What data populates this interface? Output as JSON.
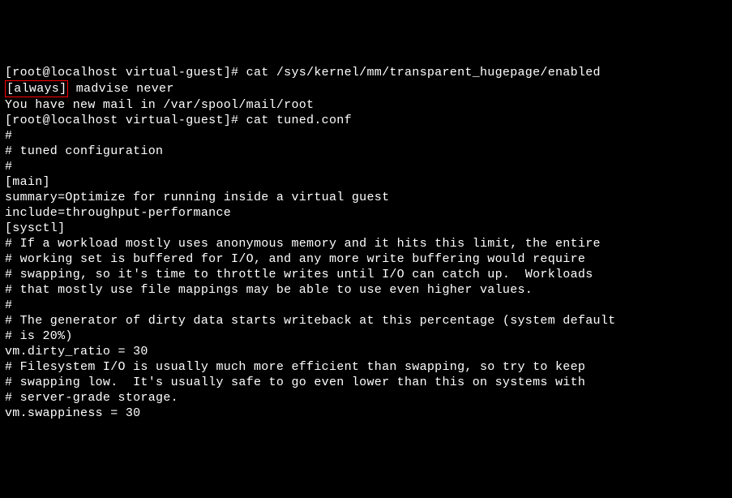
{
  "terminal": {
    "lines": [
      "[root@localhost virtual-guest]# cat /sys/kernel/mm/transparent_hugepage/enabled",
      "",
      " madvise never",
      "You have new mail in /var/spool/mail/root",
      "[root@localhost virtual-guest]# cat tuned.conf",
      "#",
      "# tuned configuration",
      "#",
      "",
      "[main]",
      "summary=Optimize for running inside a virtual guest",
      "include=throughput-performance",
      "",
      "[sysctl]",
      "# If a workload mostly uses anonymous memory and it hits this limit, the entire",
      "# working set is buffered for I/O, and any more write buffering would require",
      "# swapping, so it's time to throttle writes until I/O can catch up.  Workloads",
      "# that mostly use file mappings may be able to use even higher values.",
      "#",
      "# The generator of dirty data starts writeback at this percentage (system default",
      "# is 20%)",
      "vm.dirty_ratio = 30",
      "",
      "# Filesystem I/O is usually much more efficient than swapping, so try to keep",
      "# swapping low.  It's usually safe to go even lower than this on systems with",
      "# server-grade storage.",
      "vm.swappiness = 30"
    ],
    "highlighted": "[always]"
  }
}
